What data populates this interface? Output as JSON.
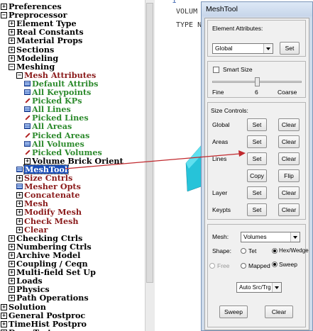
{
  "tree": {
    "items": [
      {
        "label": "Preferences",
        "expander": "⊞",
        "icon": "expander",
        "color": "black",
        "indent": 0
      },
      {
        "label": "Preprocessor",
        "expander": "⊟",
        "icon": "expander",
        "color": "black",
        "indent": 0
      },
      {
        "label": "Element Type",
        "expander": "⊞",
        "icon": "expander",
        "color": "black",
        "indent": 1
      },
      {
        "label": "Real Constants",
        "expander": "⊞",
        "icon": "expander",
        "color": "black",
        "indent": 1
      },
      {
        "label": "Material Props",
        "expander": "⊞",
        "icon": "expander",
        "color": "black",
        "indent": 1
      },
      {
        "label": "Sections",
        "expander": "⊞",
        "icon": "expander",
        "color": "black",
        "indent": 1
      },
      {
        "label": "Modeling",
        "expander": "⊞",
        "icon": "expander",
        "color": "black",
        "indent": 1
      },
      {
        "label": "Meshing",
        "expander": "⊟",
        "icon": "expander",
        "color": "black",
        "indent": 1
      },
      {
        "label": "Mesh Attributes",
        "expander": "⊟",
        "icon": "expander",
        "color": "maroon",
        "indent": 2
      },
      {
        "label": "Default Attribs",
        "icon": "grid",
        "color": "green",
        "indent": 3
      },
      {
        "label": "All Keypoints",
        "icon": "grid",
        "color": "green",
        "indent": 3
      },
      {
        "label": "Picked KPs",
        "icon": "pick",
        "color": "green",
        "indent": 3
      },
      {
        "label": "All Lines",
        "icon": "grid",
        "color": "green",
        "indent": 3
      },
      {
        "label": "Picked Lines",
        "icon": "pick",
        "color": "green",
        "indent": 3
      },
      {
        "label": "All Areas",
        "icon": "grid",
        "color": "green",
        "indent": 3
      },
      {
        "label": "Picked Areas",
        "icon": "pick",
        "color": "green",
        "indent": 3
      },
      {
        "label": "All Volumes",
        "icon": "grid",
        "color": "green",
        "indent": 3
      },
      {
        "label": "Picked Volumes",
        "icon": "pick",
        "color": "green",
        "indent": 3
      },
      {
        "label": "Volume Brick Orient",
        "expander": "⊞",
        "icon": "expander",
        "color": "black",
        "indent": 3
      },
      {
        "label": "MeshTool",
        "icon": "grid",
        "color": "selected",
        "indent": 2
      },
      {
        "label": "Size Cntrls",
        "expander": "⊞",
        "icon": "expander",
        "color": "maroon",
        "indent": 2
      },
      {
        "label": "Mesher Opts",
        "icon": "grid",
        "color": "maroon",
        "indent": 2
      },
      {
        "label": "Concatenate",
        "expander": "⊞",
        "icon": "expander",
        "color": "maroon",
        "indent": 2
      },
      {
        "label": "Mesh",
        "expander": "⊞",
        "icon": "expander",
        "color": "maroon",
        "indent": 2
      },
      {
        "label": "Modify Mesh",
        "expander": "⊞",
        "icon": "expander",
        "color": "maroon",
        "indent": 2
      },
      {
        "label": "Check Mesh",
        "expander": "⊞",
        "icon": "expander",
        "color": "maroon",
        "indent": 2
      },
      {
        "label": "Clear",
        "expander": "⊞",
        "icon": "expander",
        "color": "maroon",
        "indent": 2
      },
      {
        "label": "Checking Ctrls",
        "expander": "⊞",
        "icon": "expander",
        "color": "black",
        "indent": 1
      },
      {
        "label": "Numbering Ctrls",
        "expander": "⊞",
        "icon": "expander",
        "color": "black",
        "indent": 1
      },
      {
        "label": "Archive Model",
        "expander": "⊞",
        "icon": "expander",
        "color": "black",
        "indent": 1
      },
      {
        "label": "Coupling / Ceqn",
        "expander": "⊞",
        "icon": "expander",
        "color": "black",
        "indent": 1
      },
      {
        "label": "Multi-field Set Up",
        "expander": "⊞",
        "icon": "expander",
        "color": "black",
        "indent": 1
      },
      {
        "label": "Loads",
        "expander": "⊞",
        "icon": "expander",
        "color": "black",
        "indent": 1
      },
      {
        "label": "Physics",
        "expander": "⊞",
        "icon": "expander",
        "color": "black",
        "indent": 1
      },
      {
        "label": "Path Operations",
        "expander": "⊞",
        "icon": "expander",
        "color": "black",
        "indent": 1
      },
      {
        "label": "Solution",
        "expander": "⊞",
        "icon": "expander",
        "color": "black",
        "indent": 0
      },
      {
        "label": "General Postproc",
        "expander": "⊞",
        "icon": "expander",
        "color": "black",
        "indent": 0
      },
      {
        "label": "TimeHist Postpro",
        "expander": "⊞",
        "icon": "expander",
        "color": "black",
        "indent": 0
      },
      {
        "label": "Drop Test",
        "expander": "⊞",
        "icon": "expander",
        "color": "black",
        "indent": 0
      }
    ]
  },
  "graphics": {
    "line_number": "1",
    "text1": "VOLUM",
    "text2": "TYPE N"
  },
  "meshtool": {
    "title": "MeshTool",
    "element_attributes": {
      "label": "Element Attributes:",
      "selected": "Global",
      "set_label": "Set"
    },
    "smart_size": {
      "label": "Smart Size",
      "checked": false,
      "fine_label": "Fine",
      "value": "6",
      "coarse_label": "Coarse"
    },
    "size_controls": {
      "label": "Size Controls:",
      "rows": [
        {
          "label": "Global",
          "left": "Set",
          "right": "Clear"
        },
        {
          "label": "Areas",
          "left": "Set",
          "right": "Clear"
        },
        {
          "label": "Lines",
          "left": "Set",
          "right": "Clear"
        },
        {
          "label": "",
          "left": "Copy",
          "right": "Flip"
        },
        {
          "label": "Layer",
          "left": "Set",
          "right": "Clear"
        },
        {
          "label": "Keypts",
          "left": "Set",
          "right": "Clear"
        }
      ]
    },
    "mesh": {
      "label": "Mesh:",
      "selected": "Volumes",
      "shape_label": "Shape:",
      "shape_tet": "Tet",
      "shape_hex": "Hex/Wedge",
      "shape_selected": "Hex/Wedge",
      "free_label": "Free",
      "mapped_label": "Mapped",
      "sweep_label": "Sweep",
      "method_selected": "Sweep",
      "src_trg": "Auto Src/Trg",
      "sweep_button": "Sweep",
      "clear_button": "Clear"
    }
  },
  "colors": {
    "arrow": "#c0282d",
    "tree_green": "#2c8a2c",
    "tree_maroon": "#8a1a1a",
    "selection": "#1b4fb8"
  }
}
